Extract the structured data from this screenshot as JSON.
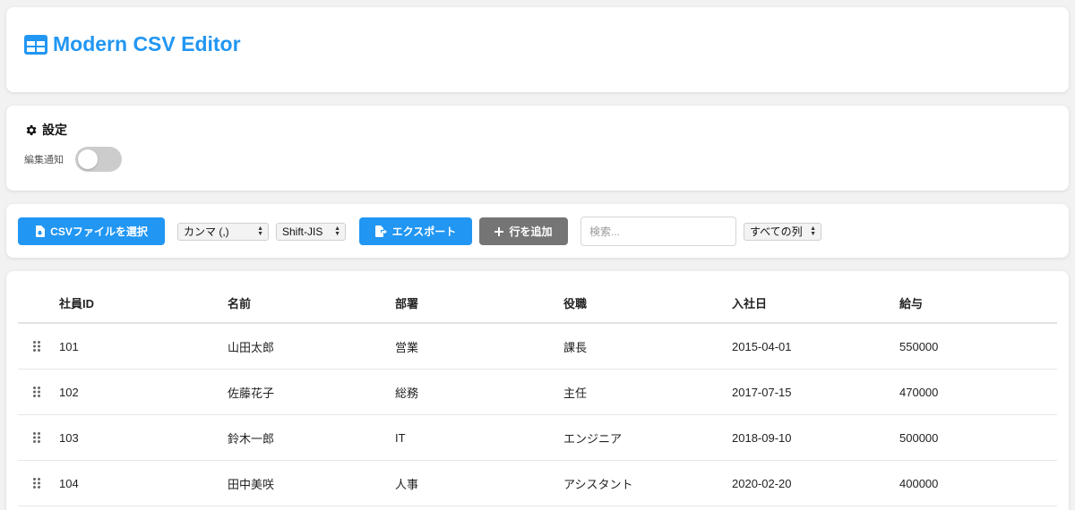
{
  "app": {
    "title": "Modern CSV Editor",
    "icon": "table-icon",
    "accent_color": "#2196f3"
  },
  "settings": {
    "title": "設定",
    "icon": "gear-icon",
    "edit_notify_label": "編集通知",
    "edit_notify_enabled": false
  },
  "toolbar": {
    "select_file_label": "CSVファイルを選択",
    "delimiter_selected": "カンマ (,)",
    "encoding_selected": "Shift-JIS",
    "export_label": "エクスポート",
    "add_row_label": "行を追加",
    "search_placeholder": "検索...",
    "column_filter_selected": "すべての列"
  },
  "table": {
    "headers": [
      "社員ID",
      "名前",
      "部署",
      "役職",
      "入社日",
      "給与"
    ],
    "rows": [
      [
        "101",
        "山田太郎",
        "営業",
        "課長",
        "2015-04-01",
        "550000"
      ],
      [
        "102",
        "佐藤花子",
        "総務",
        "主任",
        "2017-07-15",
        "470000"
      ],
      [
        "103",
        "鈴木一郎",
        "IT",
        "エンジニア",
        "2018-09-10",
        "500000"
      ],
      [
        "104",
        "田中美咲",
        "人事",
        "アシスタント",
        "2020-02-20",
        "400000"
      ]
    ]
  }
}
